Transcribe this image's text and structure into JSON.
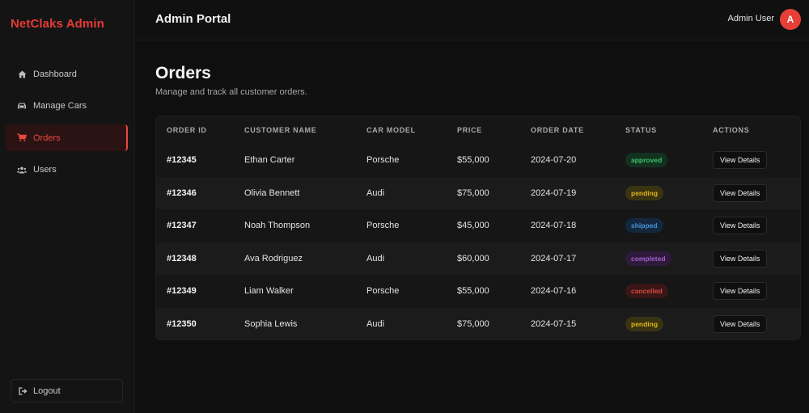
{
  "app": {
    "brand": "NetClaks Admin",
    "header_title": "Admin Portal",
    "user_name": "Admin User",
    "user_initial": "A"
  },
  "sidebar": {
    "items": [
      {
        "label": "Dashboard",
        "icon": "home-icon"
      },
      {
        "label": "Manage Cars",
        "icon": "car-icon"
      },
      {
        "label": "Orders",
        "icon": "cart-icon",
        "active": true
      },
      {
        "label": "Users",
        "icon": "users-icon"
      }
    ],
    "logout_label": "Logout"
  },
  "page": {
    "title": "Orders",
    "subtitle": "Manage and track all customer orders."
  },
  "table": {
    "headers": [
      "ORDER ID",
      "CUSTOMER NAME",
      "CAR MODEL",
      "PRICE",
      "ORDER DATE",
      "STATUS",
      "ACTIONS"
    ],
    "rows": [
      {
        "id": "#12345",
        "customer": "Ethan Carter",
        "model": "Porsche",
        "price": "$55,000",
        "date": "2024-07-20",
        "status": "approved",
        "action": "View Details"
      },
      {
        "id": "#12346",
        "customer": "Olivia Bennett",
        "model": "Audi",
        "price": "$75,000",
        "date": "2024-07-19",
        "status": "pending",
        "action": "View Details"
      },
      {
        "id": "#12347",
        "customer": "Noah Thompson",
        "model": "Porsche",
        "price": "$45,000",
        "date": "2024-07-18",
        "status": "shipped",
        "action": "View Details"
      },
      {
        "id": "#12348",
        "customer": "Ava Rodriguez",
        "model": "Audi",
        "price": "$60,000",
        "date": "2024-07-17",
        "status": "completed",
        "action": "View Details"
      },
      {
        "id": "#12349",
        "customer": "Liam Walker",
        "model": "Porsche",
        "price": "$55,000",
        "date": "2024-07-16",
        "status": "cancelled",
        "action": "View Details"
      },
      {
        "id": "#12350",
        "customer": "Sophia Lewis",
        "model": "Audi",
        "price": "$75,000",
        "date": "2024-07-15",
        "status": "pending",
        "action": "View Details"
      }
    ]
  },
  "colors": {
    "accent": "#e53f36",
    "background": "#0f0f10",
    "approved": "#3ec06a",
    "pending": "#e3b51a",
    "shipped": "#4a93d9",
    "completed": "#a45fd0",
    "cancelled": "#d24a43"
  }
}
